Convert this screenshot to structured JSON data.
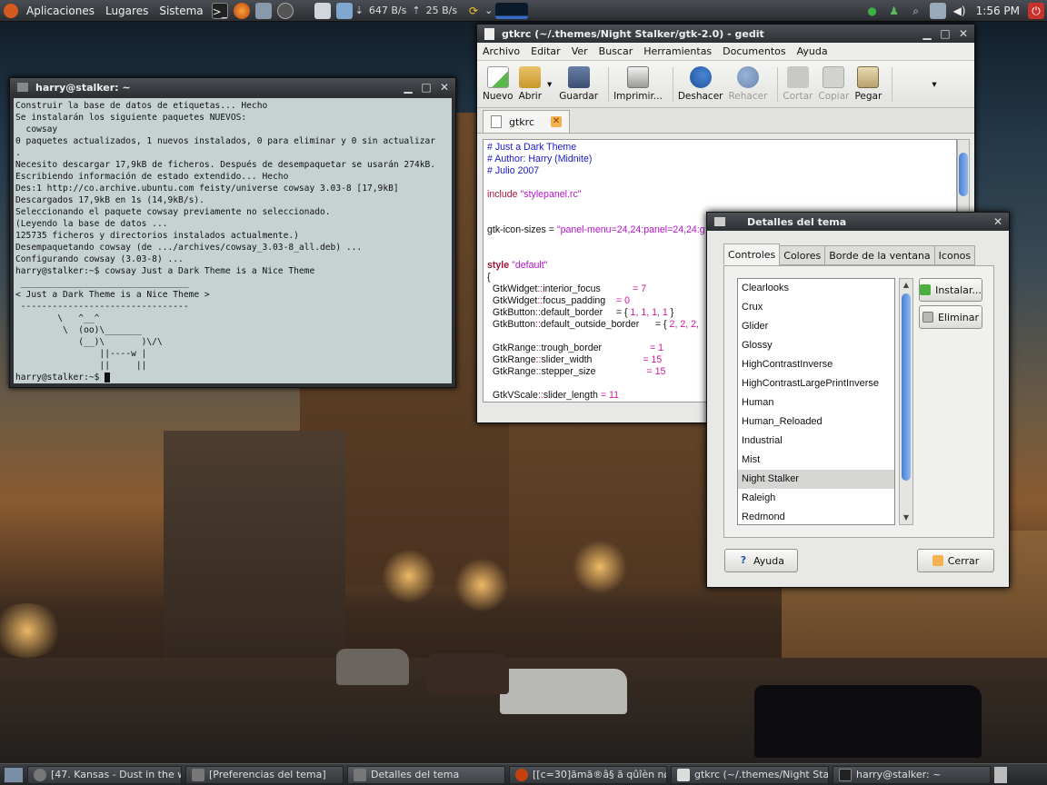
{
  "top_panel": {
    "menus": [
      "Aplicaciones",
      "Lugares",
      "Sistema"
    ],
    "download_rate": "647 B/s",
    "upload_rate": "25 B/s",
    "clock": "1:56 PM"
  },
  "terminal": {
    "title": "harry@stalker: ~",
    "lines": [
      "Construir la base de datos de etiquetas... Hecho",
      "Se instalarán los siguiente paquetes NUEVOS:",
      "  cowsay",
      "0 paquetes actualizados, 1 nuevos instalados, 0 para eliminar y 0 sin actualizar",
      ".",
      "Necesito descargar 17,9kB de ficheros. Después de desempaquetar se usarán 274kB.",
      "Escribiendo información de estado extendido... Hecho",
      "Des:1 http://co.archive.ubuntu.com feisty/universe cowsay 3.03-8 [17,9kB]",
      "Descargados 17,9kB en 1s (14,9kB/s).",
      "Seleccionando el paquete cowsay previamente no seleccionado.",
      "(Leyendo la base de datos ...",
      "125735 ficheros y directorios instalados actualmente.)",
      "Desempaquetando cowsay (de .../archives/cowsay_3.03-8_all.deb) ...",
      "Configurando cowsay (3.03-8) ...",
      "harry@stalker:~$ cowsay Just a Dark Theme is a Nice Theme",
      " ________________________________",
      "< Just a Dark Theme is a Nice Theme >",
      " --------------------------------",
      "        \\   ^__^",
      "         \\  (oo)\\_______",
      "            (__)\\       )\\/\\",
      "                ||----w |",
      "                ||     ||"
    ],
    "prompt": "harry@stalker:~$ "
  },
  "gedit": {
    "title": "gtkrc (~/.themes/Night Stalker/gtk-2.0) - gedit",
    "menu": [
      "Archivo",
      "Editar",
      "Ver",
      "Buscar",
      "Herramientas",
      "Documentos",
      "Ayuda"
    ],
    "toolbar": {
      "new": "Nuevo",
      "open": "Abrir",
      "save": "Guardar",
      "print": "Imprimir...",
      "undo": "Deshacer",
      "redo": "Rehacer",
      "cut": "Cortar",
      "copy": "Copiar",
      "paste": "Pegar"
    },
    "tab_label": "gtkrc",
    "code": [
      [
        [
          "c-comment",
          "# Just a Dark Theme"
        ]
      ],
      [
        [
          "c-comment",
          "# Author: Harry (Midnite)"
        ]
      ],
      [
        [
          "c-comment",
          "# Julio 2007"
        ]
      ],
      [],
      [
        [
          "c-sym",
          "include "
        ],
        [
          "c-str",
          "\"stylepanel.rc\""
        ]
      ],
      [],
      [],
      [
        [
          "",
          "gtk-icon-sizes = "
        ],
        [
          "c-str",
          "\"panel-menu=24,24:panel=24,24:g"
        ]
      ],
      [],
      [],
      [
        [
          "c-kw",
          "style "
        ],
        [
          "c-str",
          "\"default\""
        ]
      ],
      [
        [
          "",
          "{"
        ]
      ],
      [
        [
          "",
          "  GtkWidget"
        ],
        [
          "c-sym",
          "::"
        ],
        [
          "",
          "interior_focus            "
        ],
        [
          "c-num",
          "= 7"
        ]
      ],
      [
        [
          "",
          "  GtkWidget"
        ],
        [
          "c-sym",
          "::"
        ],
        [
          "",
          "focus_padding    "
        ],
        [
          "c-num",
          "= 0"
        ]
      ],
      [
        [
          "",
          "  GtkButton"
        ],
        [
          "c-sym",
          "::"
        ],
        [
          "",
          "default_border     = { "
        ],
        [
          "c-num",
          "1, 1, 1, 1"
        ],
        [
          "",
          " }"
        ]
      ],
      [
        [
          "",
          "  GtkButton"
        ],
        [
          "c-sym",
          "::"
        ],
        [
          "",
          "default_outside_border      = { "
        ],
        [
          "c-num",
          "2, 2, 2,"
        ]
      ],
      [],
      [
        [
          "",
          "  GtkRange"
        ],
        [
          "c-sym",
          "::"
        ],
        [
          "",
          "trough_border                  "
        ],
        [
          "c-num",
          "= 1"
        ]
      ],
      [
        [
          "",
          "  GtkRange"
        ],
        [
          "c-sym",
          "::"
        ],
        [
          "",
          "slider_width                   "
        ],
        [
          "c-num",
          "= 15"
        ]
      ],
      [
        [
          "",
          "  GtkRange"
        ],
        [
          "c-sym",
          "::"
        ],
        [
          "",
          "stepper_size                   "
        ],
        [
          "c-num",
          "= 15"
        ]
      ],
      [],
      [
        [
          "",
          "  GtkVScale"
        ],
        [
          "c-sym",
          "::"
        ],
        [
          "",
          "slider_length "
        ],
        [
          "c-num",
          "= 11"
        ]
      ]
    ]
  },
  "dialog": {
    "title": "Detalles del tema",
    "tabs": [
      "Controles",
      "Colores",
      "Borde de la ventana",
      "Iconos"
    ],
    "themes": [
      "Clearlooks",
      "Crux",
      "Glider",
      "Glossy",
      "HighContrastInverse",
      "HighContrastLargePrintInverse",
      "Human",
      "Human_Reloaded",
      "Industrial",
      "Mist",
      "Night Stalker",
      "Raleigh",
      "Redmond"
    ],
    "selected_theme": "Night Stalker",
    "install_label": "Instalar...",
    "remove_label": "Eliminar",
    "help_label": "Ayuda",
    "close_label": "Cerrar"
  },
  "taskbar": [
    "[47. Kansas - Dust in the w...",
    "[Preferencias del tema]",
    "Detalles del tema",
    "[[c=30]ãmã®â§ ã qûîèn nø t...",
    "gtkrc (~/.themes/Night Stalk...",
    "harry@stalker: ~"
  ]
}
